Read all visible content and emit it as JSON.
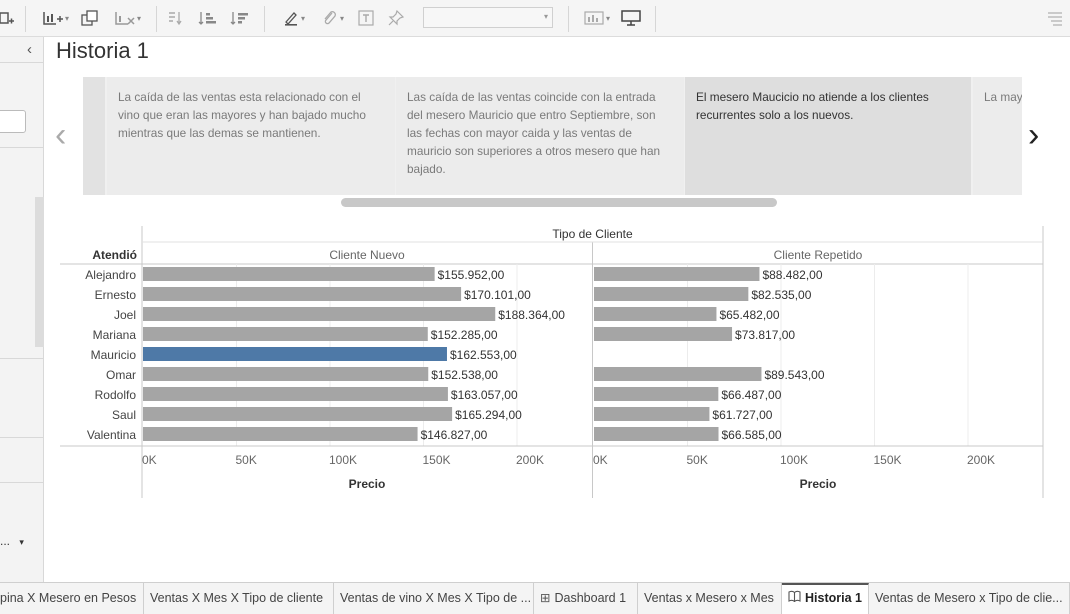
{
  "story": {
    "title": "Historia 1",
    "captions": [
      {
        "text": "La caída de las ventas esta relacionado con el vino que eran las mayores y han bajado mucho mientras que las demas se mantienen.",
        "active": false
      },
      {
        "text": "Las caída de las ventas coincide con la entrada del mesero Mauricio que entro Septiembre, son las fechas con mayor caida y las ventas de mauricio son superiores a otros mesero que han bajado.",
        "active": false
      },
      {
        "text": "El mesero Maucicio no atiende a los clientes recurrentes solo a los nuevos.",
        "active": true
      },
      {
        "text": "La may Agosto",
        "active": false
      }
    ],
    "prev_glyph": "‹",
    "next_glyph": "›"
  },
  "left_panel": {
    "collapse_glyph": "‹",
    "dropdown_text": "...",
    "dropdown_caret": "▾"
  },
  "toolbar": {
    "icons": [
      "new-datasource-icon",
      "new-worksheet-icon",
      "duplicate-icon",
      "clear-icon",
      "swap-icon",
      "sort-ascending-icon",
      "sort-descending-icon",
      "highlight-icon",
      "attach-icon",
      "text-icon",
      "pin-icon",
      "show-me-icon",
      "presentation-icon"
    ],
    "caret": "▾"
  },
  "chart_data": {
    "type": "bar",
    "title": "Tipo de Cliente",
    "row_header": "Atendió",
    "categories": [
      "Alejandro",
      "Ernesto",
      "Joel",
      "Mariana",
      "Mauricio",
      "Omar",
      "Rodolfo",
      "Saul",
      "Valentina"
    ],
    "series": [
      {
        "name": "Cliente Nuevo",
        "values": [
          155952,
          170101,
          188364,
          152285,
          162553,
          152538,
          163057,
          165294,
          146827
        ],
        "labels": [
          "$155.952,00",
          "$170.101,00",
          "$188.364,00",
          "$152.285,00",
          "$162.553,00",
          "$152.538,00",
          "$163.057,00",
          "$165.294,00",
          "$146.827,00"
        ]
      },
      {
        "name": "Cliente Repetido",
        "values": [
          88482,
          82535,
          65482,
          73817,
          null,
          89543,
          66487,
          61727,
          66585
        ],
        "labels": [
          "$88.482,00",
          "$82.535,00",
          "$65.482,00",
          "$73.817,00",
          "",
          "$89.543,00",
          "$66.487,00",
          "$61.727,00",
          "$66.585,00"
        ]
      }
    ],
    "highlighted_category": "Mauricio",
    "xlabel": "Precio",
    "xlim": [
      0,
      240000
    ],
    "ticks": [
      0,
      50000,
      100000,
      150000,
      200000
    ],
    "tick_labels": [
      "0K",
      "50K",
      "100K",
      "150K",
      "200K"
    ],
    "colors": {
      "bar": "#a5a5a5",
      "highlight": "#4e79a7",
      "grid": "#ececec",
      "axis": "#c8c8c8"
    }
  },
  "tabs": [
    {
      "label": "pina X Mesero en Pesos",
      "icon": "",
      "active": false
    },
    {
      "label": "Ventas X Mes X Tipo de cliente",
      "icon": "",
      "active": false
    },
    {
      "label": "Ventas de vino X Mes X Tipo de ...",
      "icon": "",
      "active": false
    },
    {
      "label": "Dashboard 1",
      "icon": "⊞",
      "active": false
    },
    {
      "label": "Ventas x Mesero x Mes",
      "icon": "",
      "active": false
    },
    {
      "label": "Historia 1",
      "icon": "📖",
      "active": true
    },
    {
      "label": "Ventas de Mesero x Tipo de clie...",
      "icon": "",
      "active": false
    }
  ]
}
